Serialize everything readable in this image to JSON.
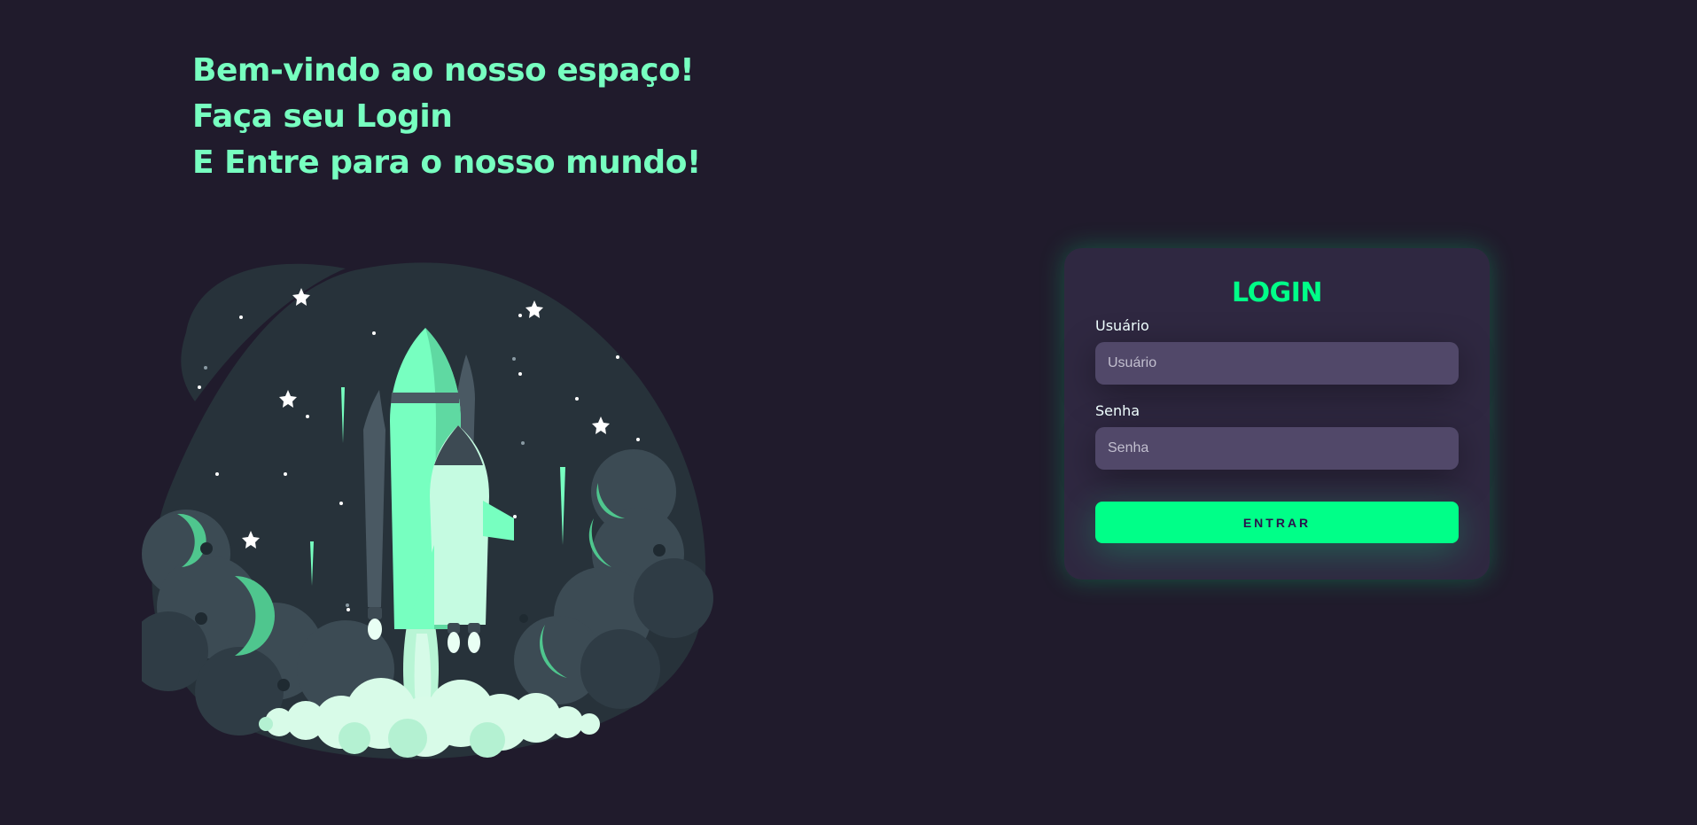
{
  "welcome": {
    "line1": "Bem-vindo ao nosso espaço!",
    "line2": "Faça seu Login",
    "line3": "E Entre para o nosso mundo!"
  },
  "illustration": {
    "icon": "rocket-launch-illustration"
  },
  "login": {
    "title": "LOGIN",
    "username_label": "Usuário",
    "username_placeholder": "Usuário",
    "username_value": "",
    "password_label": "Senha",
    "password_placeholder": "Senha",
    "password_value": "",
    "submit_label": "ENTRAR"
  },
  "colors": {
    "background": "#201b2c",
    "card": "#2f2841",
    "accent": "#00ff88",
    "heading": "#77ffc0",
    "input": "#514869"
  }
}
